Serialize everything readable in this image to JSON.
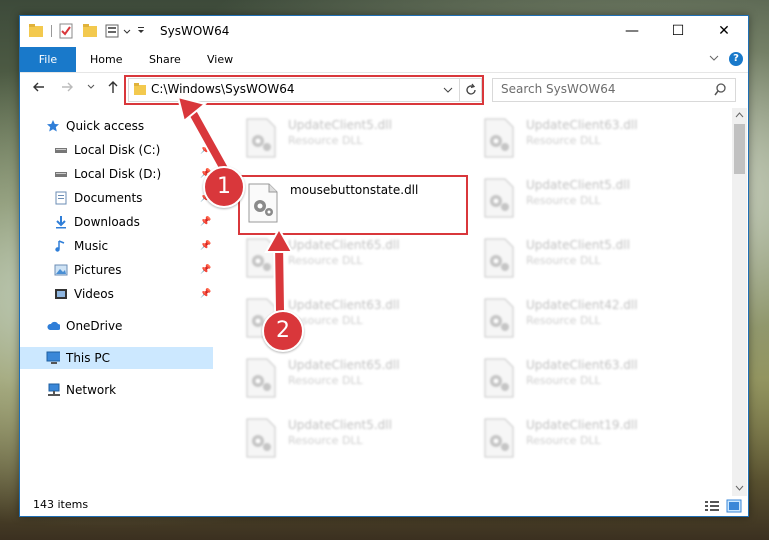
{
  "window": {
    "title": "SysWOW64"
  },
  "ribbon": {
    "tabs": [
      "File",
      "Home",
      "Share",
      "View"
    ]
  },
  "address": {
    "path": "C:\\Windows\\SysWOW64"
  },
  "search": {
    "placeholder": "Search SysWOW64"
  },
  "sidebar": {
    "items": [
      {
        "label": "Quick access",
        "icon": "star-icon"
      },
      {
        "label": "Local Disk (C:)",
        "icon": "drive-icon",
        "pinned": true
      },
      {
        "label": "Local Disk (D:)",
        "icon": "drive-icon",
        "pinned": true
      },
      {
        "label": "Documents",
        "icon": "documents-icon",
        "pinned": true
      },
      {
        "label": "Downloads",
        "icon": "download-icon",
        "pinned": true
      },
      {
        "label": "Music",
        "icon": "music-icon",
        "pinned": true
      },
      {
        "label": "Pictures",
        "icon": "pictures-icon",
        "pinned": true
      },
      {
        "label": "Videos",
        "icon": "videos-icon",
        "pinned": true
      },
      {
        "label": "OneDrive",
        "icon": "cloud-icon"
      },
      {
        "label": "This PC",
        "icon": "computer-icon",
        "selected": true
      },
      {
        "label": "Network",
        "icon": "network-icon"
      }
    ]
  },
  "files": {
    "highlighted": {
      "name": "mousebuttonstate.dll"
    },
    "left_column": [
      {
        "name": "UpdateClient5.dll",
        "type": "Resource DLL"
      },
      {
        "name": "UpdateClient65.dll",
        "type": "Resource DLL"
      },
      {
        "name": "UpdateClient63.dll",
        "type": "Resource DLL"
      },
      {
        "name": "UpdateClient65.dll",
        "type": "Resource DLL"
      },
      {
        "name": "UpdateClient5.dll",
        "type": "Resource DLL"
      }
    ],
    "right_column": [
      {
        "name": "UpdateClient63.dll",
        "type": "Resource DLL"
      },
      {
        "name": "UpdateClient5.dll",
        "type": "Resource DLL"
      },
      {
        "name": "UpdateClient5.dll",
        "type": "Resource DLL"
      },
      {
        "name": "UpdateClient42.dll",
        "type": "Resource DLL"
      },
      {
        "name": "UpdateClient63.dll",
        "type": "Resource DLL"
      },
      {
        "name": "UpdateClient19.dll",
        "type": "Resource DLL"
      }
    ]
  },
  "status": {
    "item_count": "143 items"
  },
  "annotations": {
    "step1": "1",
    "step2": "2"
  },
  "colors": {
    "accent": "#1979ca",
    "highlight": "#d9373b",
    "selection": "#cce8ff"
  }
}
